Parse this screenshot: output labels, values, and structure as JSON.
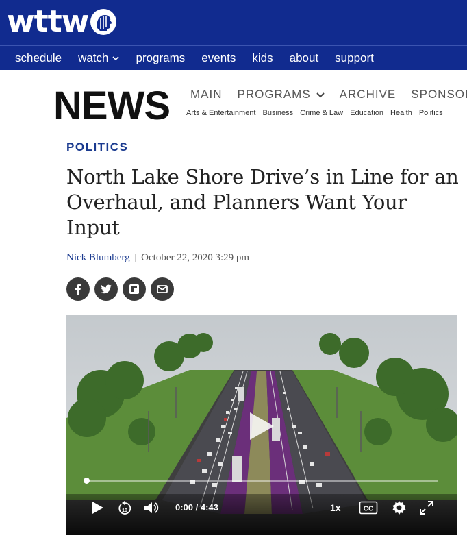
{
  "site": {
    "logo_text": "wttw",
    "nav": [
      "schedule",
      "watch",
      "programs",
      "events",
      "kids",
      "about",
      "support"
    ]
  },
  "news": {
    "logo_text": "NEWS",
    "main_nav": [
      "MAIN",
      "PROGRAMS",
      "ARCHIVE",
      "SPONSORS"
    ],
    "sub_nav": [
      "Arts & Entertainment",
      "Business",
      "Crime & Law",
      "Education",
      "Health",
      "Politics"
    ]
  },
  "article": {
    "category": "POLITICS",
    "headline": "North Lake Shore Drive’s in Line for an Overhaul, and Planners Want Your Input",
    "author": "Nick Blumberg",
    "separator": "|",
    "date": "October 22, 2020 3:29 pm"
  },
  "share_icons": [
    "facebook-icon",
    "twitter-icon",
    "flipboard-icon",
    "email-icon"
  ],
  "video": {
    "current_time": "0:00",
    "time_separator": "/",
    "duration": "4:43",
    "progress": 0.0,
    "speed": "1x",
    "cc_label": "CC",
    "rewind_seconds": "10"
  },
  "colors": {
    "brand_blue": "#112b8f",
    "category_blue": "#1a3a8f",
    "share_button": "#3a3a3a"
  }
}
